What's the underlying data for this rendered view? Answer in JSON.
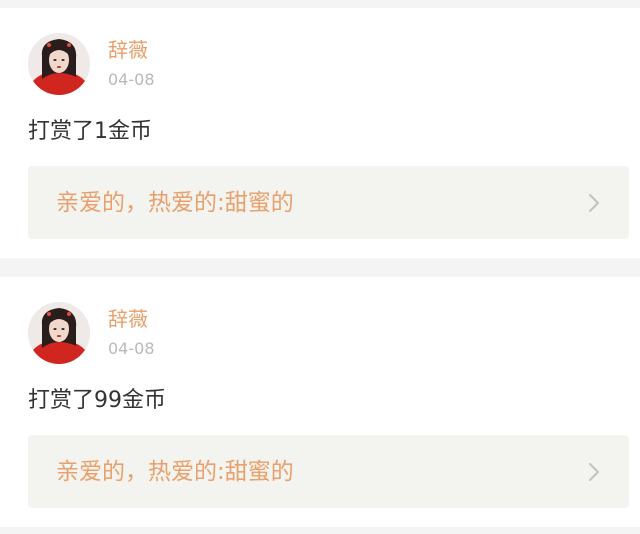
{
  "posts": [
    {
      "username": "辞薇",
      "date": "04-08",
      "message": "打赏了1金币",
      "link_text": "亲爱的，热爱的:甜蜜的"
    },
    {
      "username": "辞薇",
      "date": "04-08",
      "message": "打赏了99金币",
      "link_text": "亲爱的，热爱的:甜蜜的"
    }
  ],
  "icons": {
    "avatar": "user-avatar-portrait",
    "link_arrow": "chevron-right-icon"
  },
  "colors": {
    "username": "#e7a06b",
    "link_text": "#e9a06c",
    "date": "#b9b9b9",
    "message": "#333333",
    "link_background": "#f3f3ef",
    "page_background": "#f4f4f4"
  }
}
